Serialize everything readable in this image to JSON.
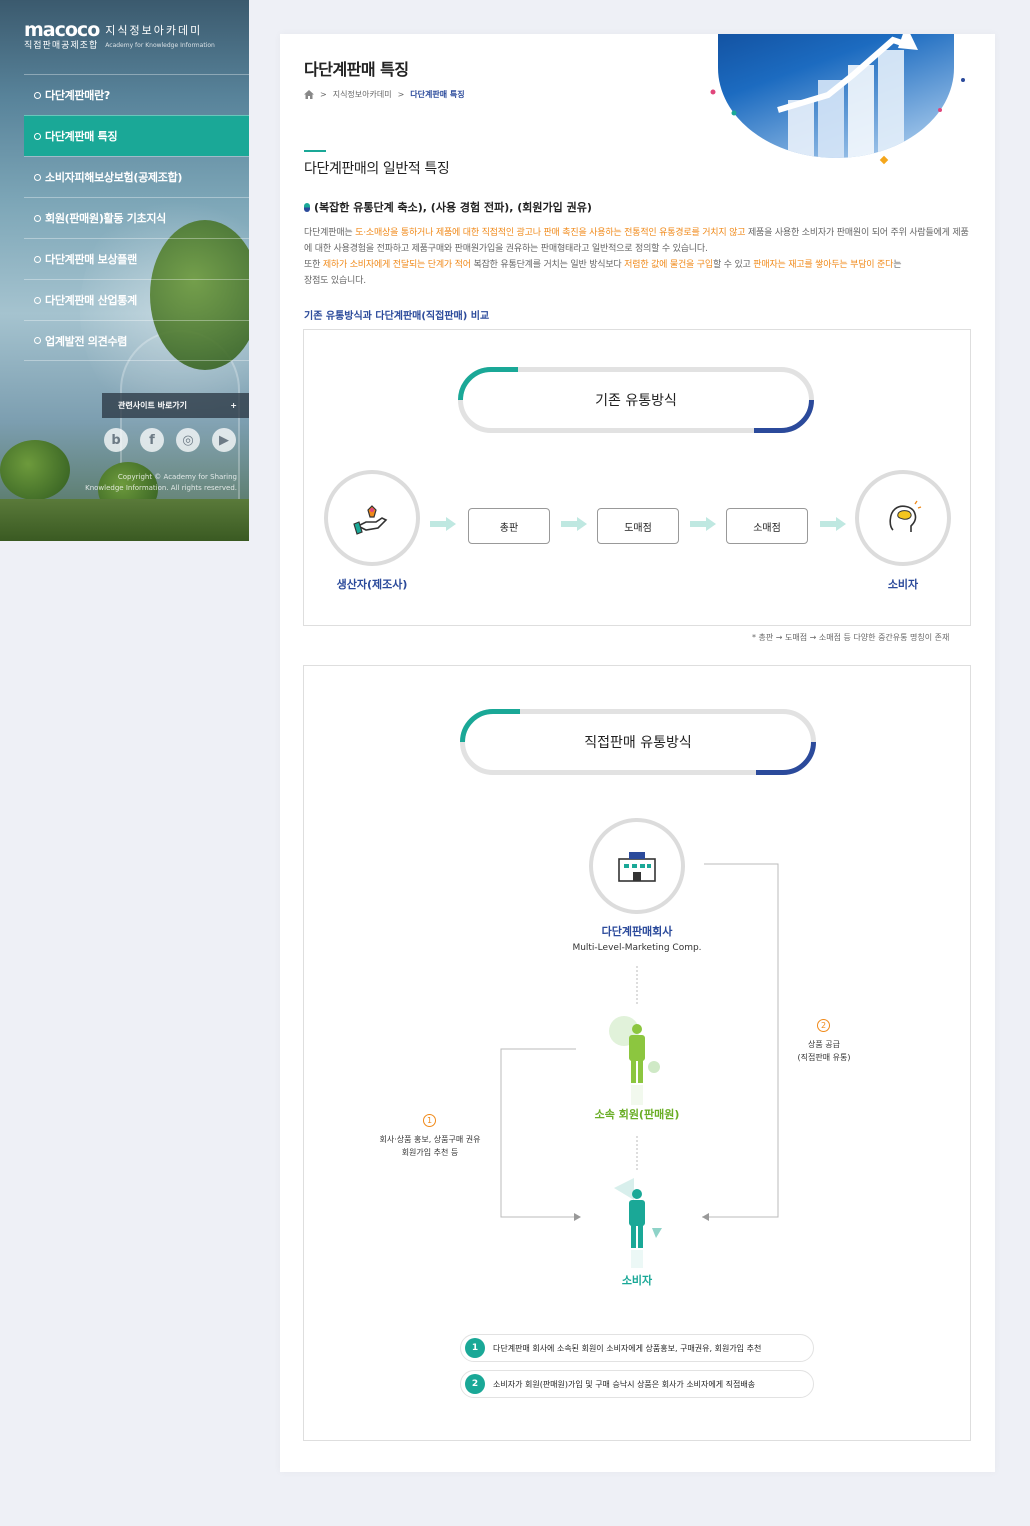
{
  "sidebar": {
    "logo_mark": "macoco",
    "logo_sub": "직접판매공제조합",
    "logo_kr": "지식정보아카데미",
    "logo_en": "Academy for Knowledge Information",
    "menu": [
      {
        "label": "다단계판매란?",
        "active": false
      },
      {
        "label": "다단계판매 특징",
        "active": true
      },
      {
        "label": "소비자피해보상보험(공제조합)",
        "active": false
      },
      {
        "label": "회원(판매원)활동 기초지식",
        "active": false
      },
      {
        "label": "다단계판매 보상플랜",
        "active": false
      },
      {
        "label": "다단계판매 산업통계",
        "active": false
      },
      {
        "label": "업계발전 의견수렴",
        "active": false
      }
    ],
    "related_label": "관련사이트 바로가기",
    "related_plus": "+",
    "social": [
      "b",
      "f",
      "◎",
      "▶"
    ],
    "copyright_1": "Copyright © Academy for Sharing",
    "copyright_2": "Knowledge Information. All rights reserved."
  },
  "main": {
    "title": "다단계판매 특징",
    "breadcrumb": {
      "home_icon": "home-icon",
      "sep": ">",
      "level1": "지식정보아카데미",
      "current": "다단계판매 특징"
    },
    "section_title": "다단계판매의 일반적 특징",
    "bullet_title": "(복잡한 유통단계 축소), (사용 경험 전파), (회원가입 권유)",
    "paragraph": {
      "p1": "다단계판매는 ",
      "p2": "도·소매상을 통하거나 제품에 대한 직접적인 광고나 판매 촉진을 사용하는 전통적인 유통경로를 거치지 않고",
      "p3": " 제품을 사용한 소비자가 판매원이 되어 주위 사람들에게 제품에 대한 사용경험을 전파하고 제품구매와 판매원가입을 권유하는 판매형태라고 일반적으로 정의할 수 있습니다.",
      "p4": "또한 ",
      "p5": "제하가 소비자에게 전달되는 단계가 적어",
      "p6": " 복잡한 유통단계를 거치는 일반 방식보다 ",
      "p7": "저렴한 값에 물건을 구입",
      "p8": "할 수 있고 ",
      "p9": "판매자는 재고를 쌓아두는 부담이 준다",
      "p10": "는",
      "p11": "장점도 있습니다."
    },
    "compare_title": "기존 유통방식과 다단계판매(직접판매) 비교",
    "existing": {
      "title": "기존 유통방식",
      "producer": "생산자(제조사)",
      "steps": [
        "총판",
        "도매점",
        "소매점"
      ],
      "consumer": "소비자"
    },
    "note": "* 총판 → 도매점 → 소매점 등 다양한 중간유통 명칭이 존재",
    "direct": {
      "title": "직접판매 유통방식",
      "company": "다단계판매회사",
      "company_en": "Multi-Level-Marketing Comp.",
      "member": "소속 회원(판매원)",
      "consumer": "소비자",
      "left_num": "1",
      "left_text_1": "회사·상품 홍보, 상품구매 권유",
      "left_text_2": "회원가입 추천 등",
      "right_num": "2",
      "right_text_1": "상품 공급",
      "right_text_2": "(직접판매 유통)",
      "legend": [
        {
          "num": "1",
          "text": "다단계판매 회사에 소속된 회원이 소비자에게 상품홍보, 구매권유, 회원가입 추천"
        },
        {
          "num": "2",
          "text": "소비자가 회원(판매원)가입 및 구매 승낙시 상품은 회사가 소비자에게 직접배송"
        }
      ]
    }
  },
  "colors": {
    "teal": "#1aa897",
    "navy": "#2b4a9b",
    "orange": "#f08a1a",
    "bg": "#eef0f6"
  }
}
